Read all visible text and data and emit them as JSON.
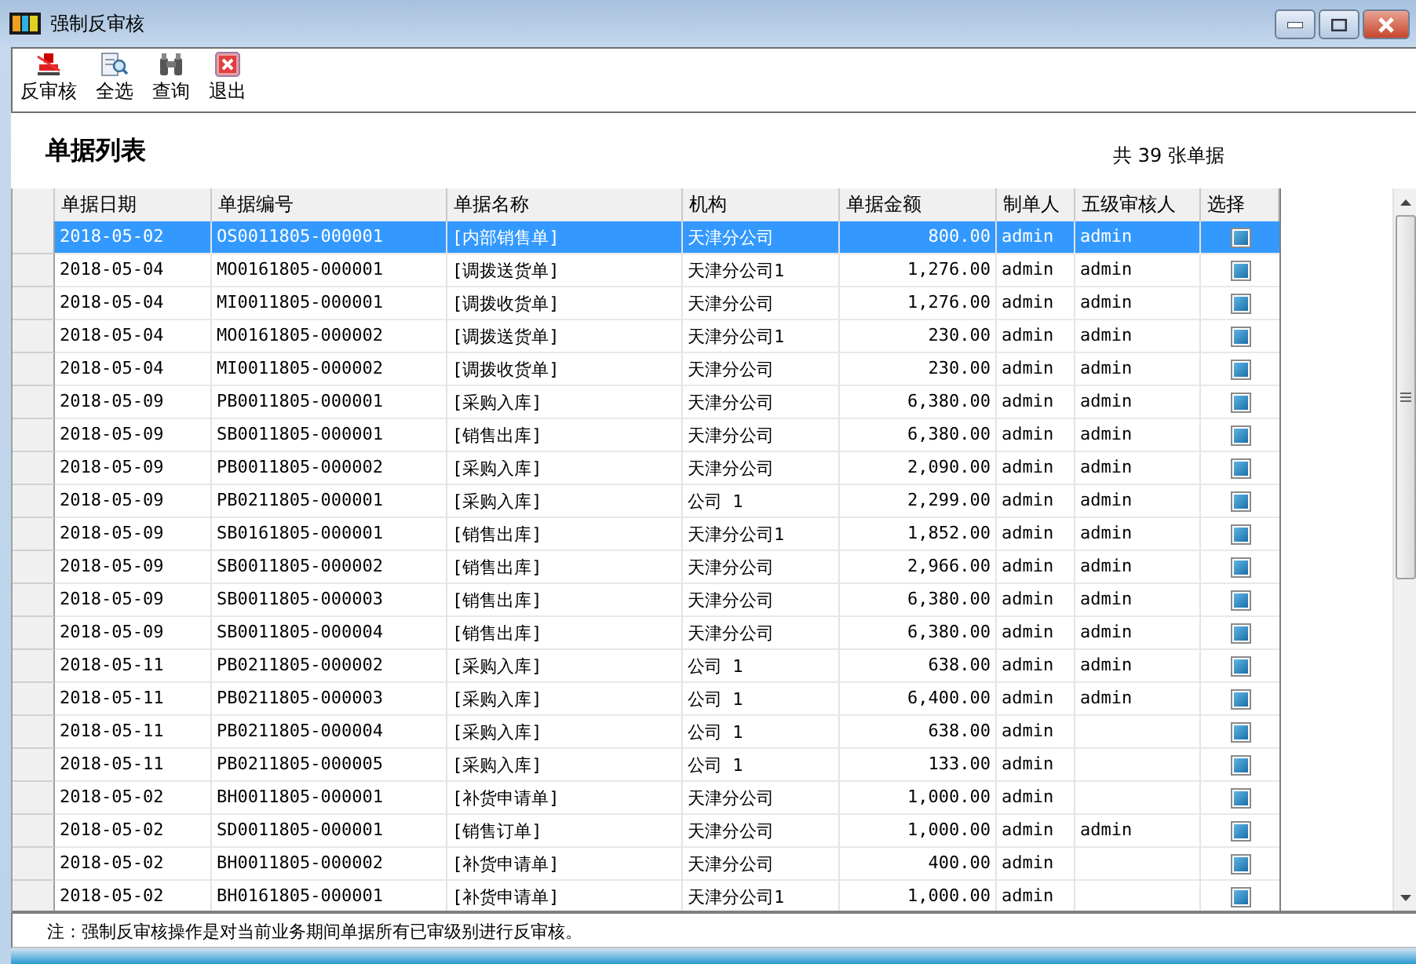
{
  "window": {
    "title": "强制反审核"
  },
  "toolbar": [
    {
      "label": "反审核",
      "kind": "unaudit"
    },
    {
      "label": "全选",
      "kind": "selectall"
    },
    {
      "label": "查询",
      "kind": "query"
    },
    {
      "label": "退出",
      "kind": "exit"
    }
  ],
  "heading": "单据列表",
  "count": "共 39 张单据",
  "table": {
    "columns": [
      "单据日期",
      "单据编号",
      "单据名称",
      "机构",
      "单据金额",
      "制单人",
      "五级审核人",
      "选择"
    ],
    "rows": [
      {
        "cells": [
          "2018-05-02",
          "OS0011805-000001",
          "[内部销售单]",
          "天津分公司",
          "800.00",
          "admin",
          "admin"
        ],
        "checked": true,
        "selected": true
      },
      {
        "cells": [
          "2018-05-04",
          "MO0161805-000001",
          "[调拨送货单]",
          "天津分公司1",
          "1,276.00",
          "admin",
          "admin"
        ],
        "checked": true,
        "selected": false
      },
      {
        "cells": [
          "2018-05-04",
          "MI0011805-000001",
          "[调拨收货单]",
          "天津分公司",
          "1,276.00",
          "admin",
          "admin"
        ],
        "checked": true,
        "selected": false
      },
      {
        "cells": [
          "2018-05-04",
          "MO0161805-000002",
          "[调拨送货单]",
          "天津分公司1",
          "230.00",
          "admin",
          "admin"
        ],
        "checked": true,
        "selected": false
      },
      {
        "cells": [
          "2018-05-04",
          "MI0011805-000002",
          "[调拨收货单]",
          "天津分公司",
          "230.00",
          "admin",
          "admin"
        ],
        "checked": true,
        "selected": false
      },
      {
        "cells": [
          "2018-05-09",
          "PB0011805-000001",
          "[采购入库]",
          "天津分公司",
          "6,380.00",
          "admin",
          "admin"
        ],
        "checked": true,
        "selected": false
      },
      {
        "cells": [
          "2018-05-09",
          "SB0011805-000001",
          "[销售出库]",
          "天津分公司",
          "6,380.00",
          "admin",
          "admin"
        ],
        "checked": true,
        "selected": false
      },
      {
        "cells": [
          "2018-05-09",
          "PB0011805-000002",
          "[采购入库]",
          "天津分公司",
          "2,090.00",
          "admin",
          "admin"
        ],
        "checked": true,
        "selected": false
      },
      {
        "cells": [
          "2018-05-09",
          "PB0211805-000001",
          "[采购入库]",
          "公司 1",
          "2,299.00",
          "admin",
          "admin"
        ],
        "checked": true,
        "selected": false
      },
      {
        "cells": [
          "2018-05-09",
          "SB0161805-000001",
          "[销售出库]",
          "天津分公司1",
          "1,852.00",
          "admin",
          "admin"
        ],
        "checked": true,
        "selected": false
      },
      {
        "cells": [
          "2018-05-09",
          "SB0011805-000002",
          "[销售出库]",
          "天津分公司",
          "2,966.00",
          "admin",
          "admin"
        ],
        "checked": true,
        "selected": false
      },
      {
        "cells": [
          "2018-05-09",
          "SB0011805-000003",
          "[销售出库]",
          "天津分公司",
          "6,380.00",
          "admin",
          "admin"
        ],
        "checked": true,
        "selected": false
      },
      {
        "cells": [
          "2018-05-09",
          "SB0011805-000004",
          "[销售出库]",
          "天津分公司",
          "6,380.00",
          "admin",
          "admin"
        ],
        "checked": true,
        "selected": false
      },
      {
        "cells": [
          "2018-05-11",
          "PB0211805-000002",
          "[采购入库]",
          "公司 1",
          "638.00",
          "admin",
          "admin"
        ],
        "checked": true,
        "selected": false
      },
      {
        "cells": [
          "2018-05-11",
          "PB0211805-000003",
          "[采购入库]",
          "公司 1",
          "6,400.00",
          "admin",
          "admin"
        ],
        "checked": true,
        "selected": false
      },
      {
        "cells": [
          "2018-05-11",
          "PB0211805-000004",
          "[采购入库]",
          "公司 1",
          "638.00",
          "admin"
        ],
        "checked": true,
        "selected": false
      },
      {
        "cells": [
          "2018-05-11",
          "PB0211805-000005",
          "[采购入库]",
          "公司 1",
          "133.00",
          "admin"
        ],
        "checked": true,
        "selected": false
      },
      {
        "cells": [
          "2018-05-02",
          "BH0011805-000001",
          "[补货申请单]",
          "天津分公司",
          "1,000.00",
          "admin"
        ],
        "checked": true,
        "selected": false
      },
      {
        "cells": [
          "2018-05-02",
          "SD0011805-000001",
          "[销售订单]",
          "天津分公司",
          "1,000.00",
          "admin",
          "admin"
        ],
        "checked": true,
        "selected": false
      },
      {
        "cells": [
          "2018-05-02",
          "BH0011805-000002",
          "[补货申请单]",
          "天津分公司",
          "400.00",
          "admin"
        ],
        "checked": true,
        "selected": false
      },
      {
        "cells": [
          "2018-05-02",
          "BH0161805-000001",
          "[补货申请单]",
          "天津分公司1",
          "1,000.00",
          "admin"
        ],
        "checked": true,
        "selected": false
      }
    ]
  },
  "note": "注：强制反审核操作是对当前业务期间单据所有已审级别进行反审核。"
}
